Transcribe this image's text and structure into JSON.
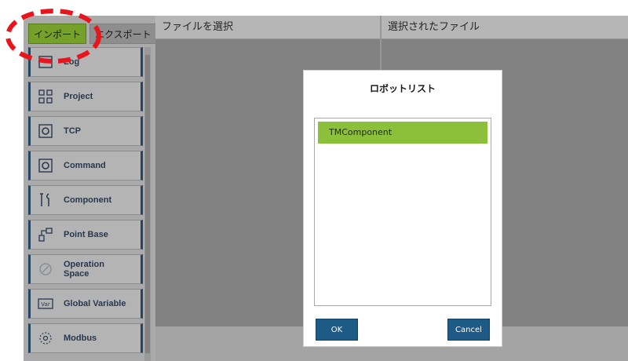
{
  "tabs": {
    "import_label": "インポート",
    "export_label": "エクスポート"
  },
  "sidebar": {
    "items": [
      {
        "label": "Log"
      },
      {
        "label": "Project"
      },
      {
        "label": "TCP"
      },
      {
        "label": "Command"
      },
      {
        "label": "Component"
      },
      {
        "label": "Point Base"
      },
      {
        "label": "Operation\nSpace"
      },
      {
        "label": "Global Variable"
      },
      {
        "label": "Modbus"
      }
    ]
  },
  "panels": {
    "left_title": "ファイルを選択",
    "right_title": "選択されたファイル"
  },
  "dialog": {
    "title": "ロボットリスト",
    "list_items": [
      "TMComponent"
    ],
    "ok_label": "OK",
    "cancel_label": "Cancel"
  },
  "colors": {
    "accent_green": "#8cc03b",
    "button_blue": "#1d5a86",
    "sidebar_border": "#2b4a6b",
    "highlight_red": "#e8151c"
  }
}
